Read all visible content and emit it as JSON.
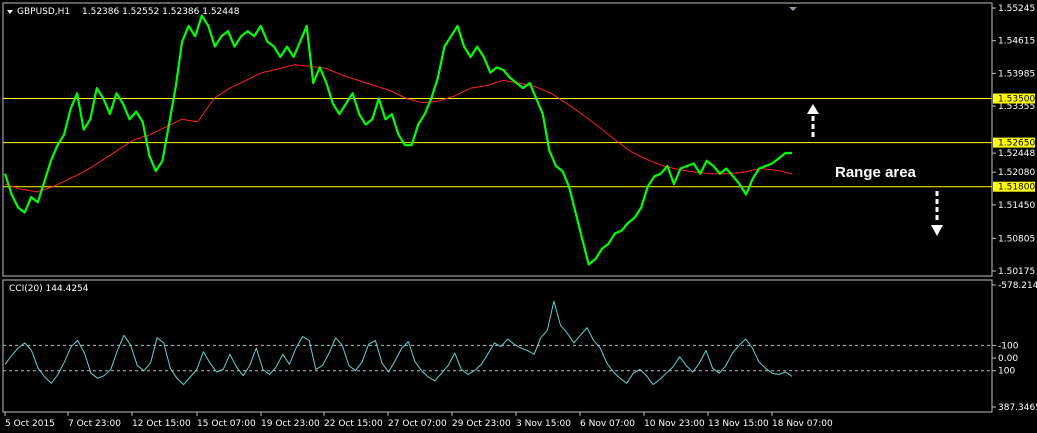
{
  "header": {
    "symbol": "GBPUSD,H1",
    "ohlc": "1.52386 1.52552 1.52386 1.52448"
  },
  "annotation": {
    "range_label": "Range area"
  },
  "colors": {
    "background": "#000000",
    "price": "#00ff00",
    "ma": "#ff2020",
    "levels": "#ffff00",
    "cci": "#5fd3d3",
    "frame": "#c0c0c0",
    "level_tag_bg": "#ffff00"
  },
  "chart_data": [
    {
      "type": "line",
      "symbol": "GBPUSD,H1",
      "ylim": [
        1.50175,
        1.55245
      ],
      "y_ticks": [
        "1.55245",
        "1.54615",
        "1.53985",
        "1.53355",
        "1.52448",
        "1.52080",
        "1.51450",
        "1.50805",
        "1.50175"
      ],
      "x_ticks": [
        "5 Oct 2015",
        "7 Oct 23:00",
        "12 Oct 15:00",
        "15 Oct 07:00",
        "19 Oct 23:00",
        "22 Oct 15:00",
        "27 Oct 07:00",
        "29 Oct 23:00",
        "3 Nov 15:00",
        "6 Nov 07:00",
        "10 Nov 23:00",
        "13 Nov 15:00",
        "18 Nov 07:00"
      ],
      "current_price": "1.52448",
      "levels": [
        {
          "value": 1.535,
          "label": "1.53500"
        },
        {
          "value": 1.5265,
          "label": "1.52650"
        },
        {
          "value": 1.518,
          "label": "1.51800"
        }
      ],
      "series": [
        {
          "values": [
            1.5205,
            1.5165,
            1.514,
            1.513,
            1.516,
            1.515,
            1.519,
            1.523,
            1.526,
            1.528,
            1.533,
            1.536,
            1.529,
            1.531,
            1.537,
            1.535,
            1.532,
            1.536,
            1.534,
            1.531,
            1.5325,
            1.5305,
            1.524,
            1.521,
            1.523,
            1.53,
            1.537,
            1.546,
            1.549,
            1.547,
            1.551,
            1.549,
            1.545,
            1.547,
            1.548,
            1.545,
            1.547,
            1.548,
            1.547,
            1.549,
            1.546,
            1.545,
            1.543,
            1.545,
            1.543,
            1.546,
            1.549,
            1.538,
            1.541,
            1.538,
            1.534,
            1.532,
            1.534,
            1.536,
            1.532,
            1.53,
            1.531,
            1.535,
            1.531,
            1.532,
            1.528,
            1.526,
            1.526,
            1.53,
            1.532,
            1.535,
            1.539,
            1.545,
            1.547,
            1.549,
            1.545,
            1.543,
            1.545,
            1.543,
            1.54,
            1.541,
            1.5405,
            1.539,
            1.538,
            1.537,
            1.538,
            1.535,
            1.532,
            1.525,
            1.522,
            1.521,
            1.518,
            1.513,
            1.508,
            1.503,
            1.504,
            1.506,
            1.507,
            1.509,
            1.5095,
            1.511,
            1.512,
            1.514,
            1.518,
            1.52,
            1.5205,
            1.522,
            1.5185,
            1.5215,
            1.522,
            1.5225,
            1.5205,
            1.523,
            1.522,
            1.5205,
            1.5215,
            1.52,
            1.5185,
            1.5165,
            1.5195,
            1.5215,
            1.522,
            1.5225,
            1.5235,
            1.5245,
            1.5245
          ]
        },
        {
          "values": [
            1.5185,
            1.5175,
            1.517,
            1.518,
            1.5195,
            1.521,
            1.523,
            1.525,
            1.527,
            1.528,
            1.5295,
            1.531,
            1.5305,
            1.535,
            1.537,
            1.5385,
            1.54,
            1.5407,
            1.5415,
            1.5412,
            1.5408,
            1.5395,
            1.5385,
            1.5375,
            1.5365,
            1.535,
            1.5342,
            1.5345,
            1.5355,
            1.537,
            1.5375,
            1.5385,
            1.538,
            1.5373,
            1.536,
            1.534,
            1.5318,
            1.5295,
            1.527,
            1.5247,
            1.5232,
            1.522,
            1.5213,
            1.5208,
            1.5205,
            1.5205,
            1.5208,
            1.5215,
            1.5212,
            1.5205
          ]
        }
      ]
    },
    {
      "type": "line",
      "title": "CCI(20) 144.4254",
      "ylim": [
        -578.214,
        387.3465
      ],
      "y_ticks": [
        "387.3465",
        "100",
        "0.00",
        "-100",
        "-578.214"
      ],
      "levels": [
        100,
        -100
      ],
      "series": [
        {
          "values": [
            50,
            -20,
            -80,
            -120,
            -60,
            80,
            150,
            200,
            130,
            30,
            -90,
            -140,
            -40,
            120,
            160,
            140,
            90,
            -60,
            -180,
            -100,
            60,
            100,
            40,
            -160,
            -120,
            80,
            160,
            210,
            150,
            90,
            -50,
            40,
            110,
            90,
            -30,
            70,
            140,
            60,
            -80,
            90,
            130,
            70,
            -30,
            50,
            -80,
            -170,
            -140,
            90,
            60,
            -40,
            -160,
            -100,
            60,
            100,
            30,
            -110,
            -140,
            40,
            110,
            20,
            -80,
            -130,
            30,
            100,
            150,
            180,
            120,
            60,
            -40,
            90,
            130,
            100,
            50,
            -30,
            -120,
            -90,
            -150,
            -110,
            -80,
            -60,
            -30,
            -160,
            -220,
            -450,
            -260,
            -200,
            -120,
            -180,
            -240,
            -140,
            -80,
            40,
            110,
            160,
            200,
            120,
            90,
            140,
            210,
            170,
            120,
            70,
            -10,
            60,
            110,
            40,
            -60,
            80,
            120,
            60,
            -40,
            -100,
            -150,
            -80,
            30,
            80,
            120,
            130,
            110,
            144
          ]
        }
      ]
    }
  ]
}
